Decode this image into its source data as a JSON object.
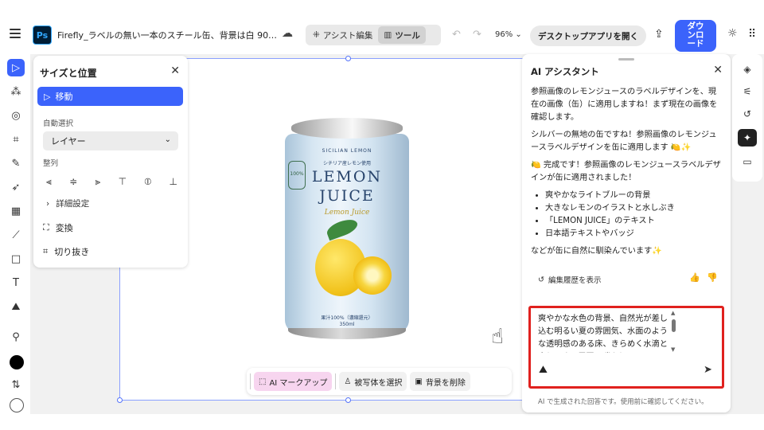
{
  "header": {
    "app_logo": "Ps",
    "doc_title": "Firefly_ラベルの無い一本のスチール缶、背景は白 90…",
    "mode_assist": "アシスト編集",
    "mode_tools": "ツール",
    "zoom": "96%",
    "open_desktop": "デスクトップアプリを開く",
    "download": "ダウンロード"
  },
  "size_panel": {
    "title": "サイズと位置",
    "move": "移動",
    "auto_select_label": "自動選択",
    "auto_select_value": "レイヤー",
    "align_label": "整列",
    "detail": "詳細設定",
    "transform": "変換",
    "crop": "切り抜き"
  },
  "can": {
    "brand_top": "SICILIAN LEMON",
    "sub": "シチリア産レモン使用",
    "badge": "100%",
    "line1": "LEMON",
    "line2": "JUICE",
    "script": "Lemon Juice",
    "juice_text": "果汁100%（濃縮還元）",
    "volume": "350ml"
  },
  "float_toolbar": {
    "ai_markup": "AI マークアップ",
    "select_subject": "被写体を選択",
    "remove_bg": "背景を削除"
  },
  "ai_panel": {
    "title": "AI アシスタント",
    "msg1": "参照画像のレモンジュースのラベルデザインを、現在の画像（缶）に適用しますね！まず現在の画像を確認します。",
    "msg2": "シルバーの無地の缶ですね！参照画像のレモンジュースラベルデザインを缶に適用します 🍋✨",
    "msg3": "🍋 完成です！参照画像のレモンジュースラベルデザインが缶に適用されました！",
    "bullets": [
      "爽やかなライトブルーの背景",
      "大きなレモンのイラストと水しぶき",
      "「LEMON JUICE」のテキスト",
      "日本語テキストやバッジ"
    ],
    "msg4": "などが缶に自然に馴染んでいます✨",
    "history": "編集履歴を表示",
    "prompt": "爽やかな水色の背景、自然光が差し込む明るい夏の雰囲気、水面のような透明感のある床、きらめく水滴と水しぶき、周囲に瑞々しいレモン",
    "footer": "AI で生成された回答です。使用前に確認してください。"
  }
}
